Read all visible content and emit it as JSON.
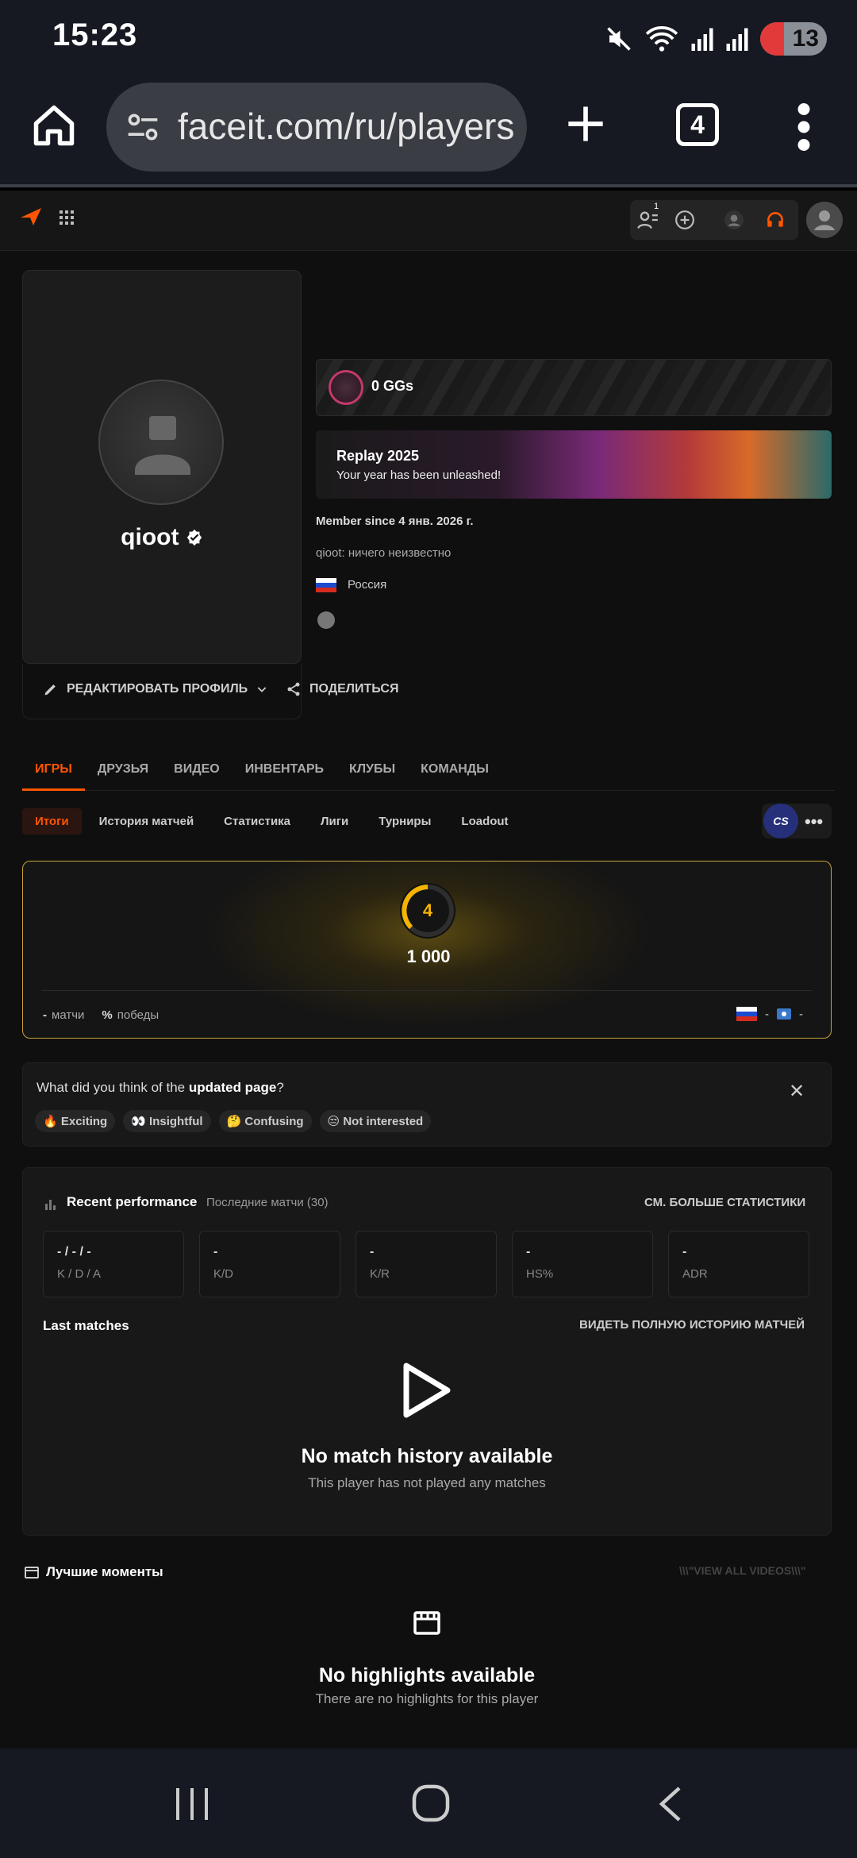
{
  "status_bar": {
    "time": "15:23",
    "battery": "13"
  },
  "browser": {
    "url": "faceit.com/ru/players",
    "tab_count": "4"
  },
  "profile": {
    "name": "qioot",
    "edit_label": "РЕДАКТИРОВАТЬ ПРОФИЛЬ",
    "share_label": "ПОДЕЛИТЬСЯ",
    "ggs": "0 GGs",
    "replay_title": "Replay 2025",
    "replay_sub": "Your year has been unleashed!",
    "member_since": "Member since 4 янв. 2026 г.",
    "bio": "qioot: ничего неизвестно",
    "country": "Россия"
  },
  "main_tabs": [
    "ИГРЫ",
    "ДРУЗЬЯ",
    "ВИДЕО",
    "ИНВЕНТАРЬ",
    "КЛУБЫ",
    "КОМАНДЫ"
  ],
  "sub_tabs": [
    "Итоги",
    "История матчей",
    "Статистика",
    "Лиги",
    "Турниры",
    "Loadout"
  ],
  "game_badge": "CS",
  "elo": {
    "level": "4",
    "value": "1 000",
    "matches_val": "-",
    "matches_lbl": "матчи",
    "wins_val": "%",
    "wins_lbl": "победы",
    "region_val": "-",
    "country_val": "-"
  },
  "feedback": {
    "question_pre": "What did you think of the ",
    "question_bold": "updated page",
    "question_post": "?",
    "chips": [
      "🔥 Exciting",
      "👀 Insightful",
      "🤔 Confusing",
      "😒 Not interested"
    ]
  },
  "performance": {
    "title": "Recent performance",
    "subtitle": "Последние матчи (30)",
    "more": "СМ. БОЛЬШЕ СТАТИСТИКИ",
    "stats": [
      {
        "value": "- / - / -",
        "label": "K / D / A"
      },
      {
        "value": "-",
        "label": "K/D"
      },
      {
        "value": "-",
        "label": "K/R"
      },
      {
        "value": "-",
        "label": "HS%"
      },
      {
        "value": "-",
        "label": "ADR"
      }
    ],
    "last_matches": "Last matches",
    "history_link": "ВИДЕТЬ ПОЛНУЮ ИСТОРИЮ МАТЧЕЙ",
    "empty_title": "No match history available",
    "empty_sub": "This player has not played any matches"
  },
  "highlights": {
    "title": "Лучшие моменты",
    "view_all": "\\\\\\\"VIEW ALL VIDEOS\\\\\\\"",
    "empty_title": "No highlights available",
    "empty_sub": "There are no highlights for this player"
  },
  "colors": {
    "accent": "#ff5500",
    "gold": "#f5b400",
    "bg": "#0f0f0f"
  }
}
